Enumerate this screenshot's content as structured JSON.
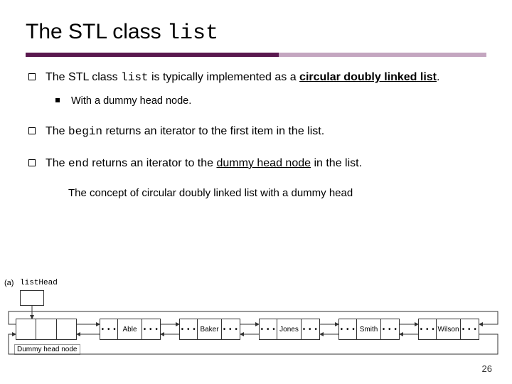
{
  "title_prefix": "The STL class ",
  "title_code": "list",
  "bullets": {
    "b1_pre": "The STL class ",
    "b1_code": "list",
    "b1_mid": " is typically implemented as a ",
    "b1_ul": "circular doubly linked list",
    "b1_post": ".",
    "b1_sub": "With a dummy head node.",
    "b2_pre": "The ",
    "b2_code": "begin",
    "b2_post": " returns an iterator to the first item in the list.",
    "b3_pre": "The ",
    "b3_code": "end",
    "b3_mid": " returns an iterator to the ",
    "b3_ul": "dummy head node",
    "b3_post": " in the list."
  },
  "caption": "The concept of circular doubly linked list with a dummy head",
  "diagram": {
    "fig_label": "(a)",
    "listhead": "listHead",
    "dots": "• • •",
    "names": [
      "Able",
      "Baker",
      "Jones",
      "Smith",
      "Wilson"
    ],
    "dummy_caption": "Dummy head node"
  },
  "page_number": "26"
}
